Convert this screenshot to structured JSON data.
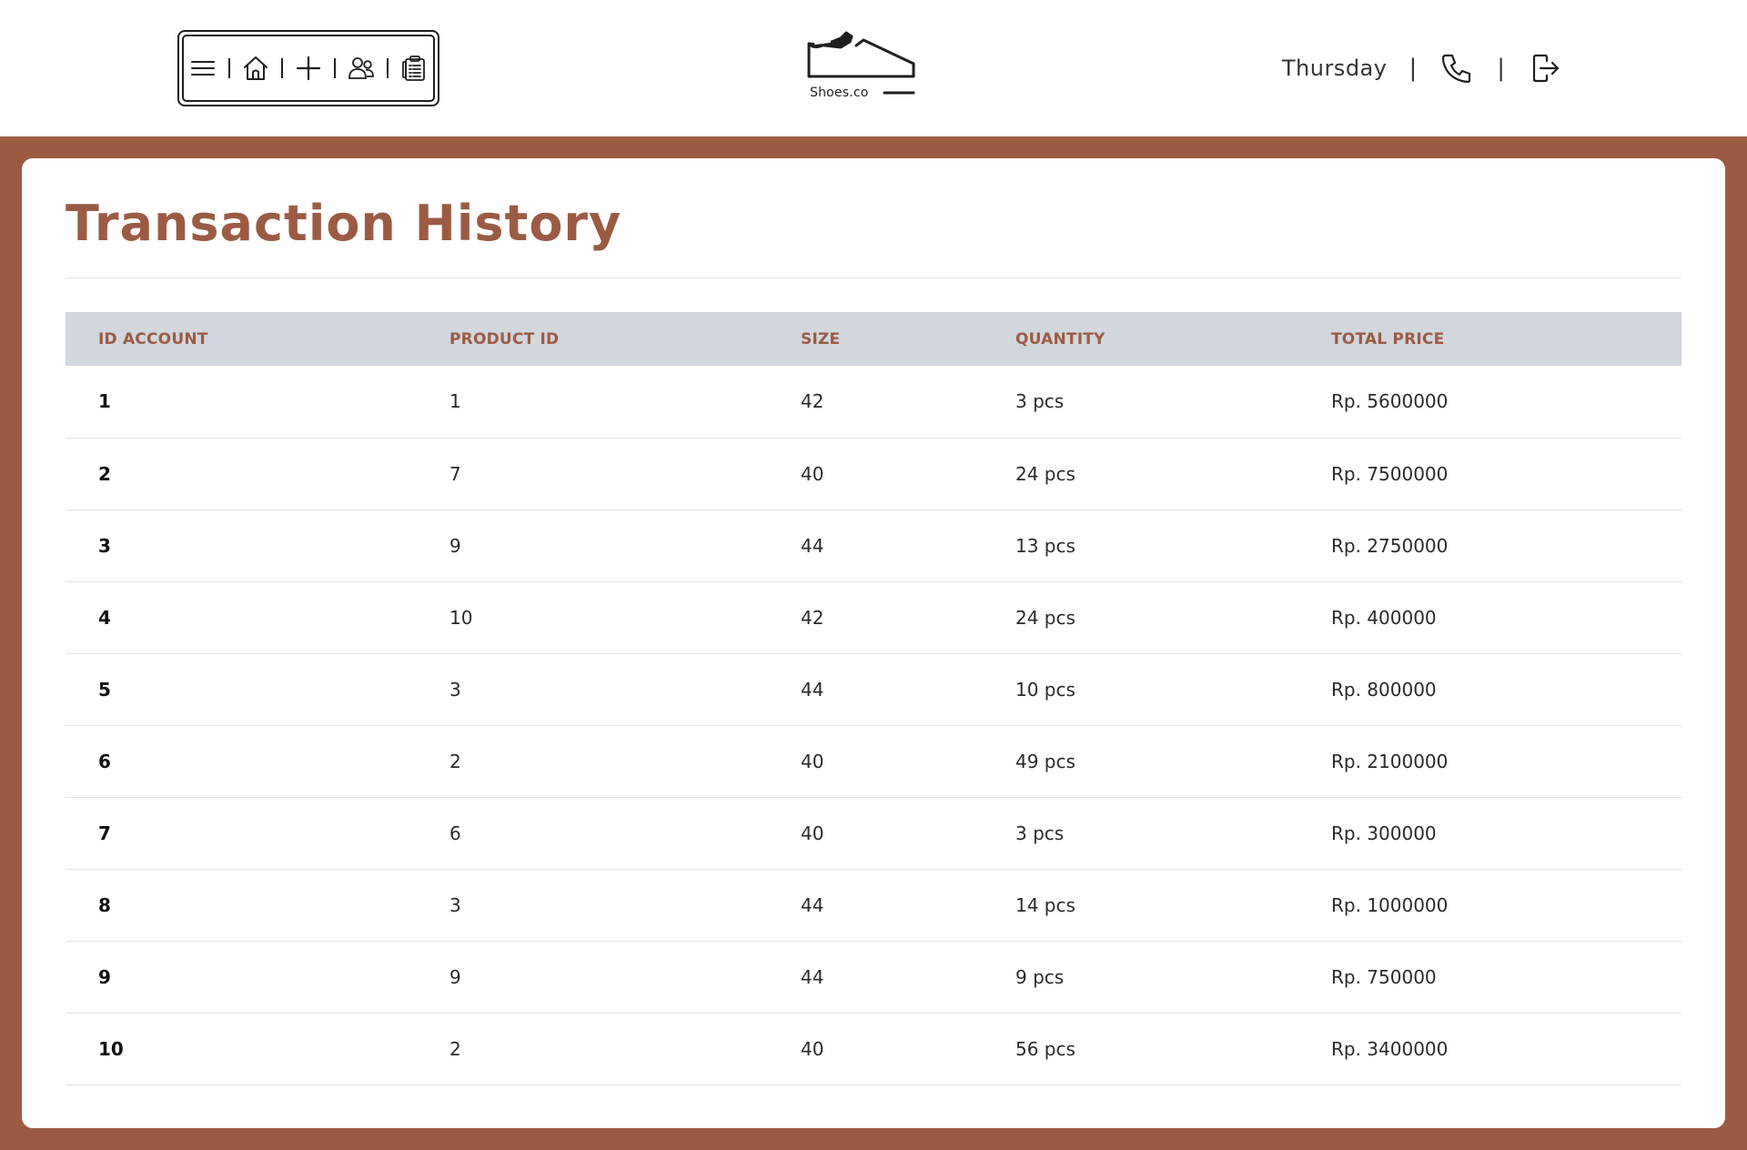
{
  "header": {
    "toolbar": {
      "buttons": [
        {
          "icon": "menu-icon"
        },
        {
          "icon": "home-icon"
        },
        {
          "icon": "plus-icon"
        },
        {
          "icon": "users-icon"
        },
        {
          "icon": "clipboard-icon"
        }
      ]
    },
    "logo": {
      "text": "Shoes.co",
      "icon": "shoe-icon"
    },
    "right": {
      "day": "Thursday",
      "separator": "|",
      "phone_icon": "phone-icon",
      "logout_icon": "logout-icon"
    }
  },
  "colors": {
    "accent": "#9b5b43",
    "table_header_bg": "#d2d6dd",
    "background": "#ffffff"
  },
  "main": {
    "title": "Transaction History",
    "table": {
      "columns": [
        "ID ACCOUNT",
        "PRODUCT ID",
        "SIZE",
        "QUANTITY",
        "TOTAL PRICE"
      ],
      "rows": [
        {
          "id_account": "1",
          "product_id": "1",
          "size": "42",
          "quantity": "3 pcs",
          "total_price": "Rp. 5600000"
        },
        {
          "id_account": "2",
          "product_id": "7",
          "size": "40",
          "quantity": "24 pcs",
          "total_price": "Rp. 7500000"
        },
        {
          "id_account": "3",
          "product_id": "9",
          "size": "44",
          "quantity": "13 pcs",
          "total_price": "Rp. 2750000"
        },
        {
          "id_account": "4",
          "product_id": "10",
          "size": "42",
          "quantity": "24 pcs",
          "total_price": "Rp. 400000"
        },
        {
          "id_account": "5",
          "product_id": "3",
          "size": "44",
          "quantity": "10 pcs",
          "total_price": "Rp. 800000"
        },
        {
          "id_account": "6",
          "product_id": "2",
          "size": "40",
          "quantity": "49 pcs",
          "total_price": "Rp. 2100000"
        },
        {
          "id_account": "7",
          "product_id": "6",
          "size": "40",
          "quantity": "3 pcs",
          "total_price": "Rp. 300000"
        },
        {
          "id_account": "8",
          "product_id": "3",
          "size": "44",
          "quantity": "14 pcs",
          "total_price": "Rp. 1000000"
        },
        {
          "id_account": "9",
          "product_id": "9",
          "size": "44",
          "quantity": "9 pcs",
          "total_price": "Rp. 750000"
        },
        {
          "id_account": "10",
          "product_id": "2",
          "size": "40",
          "quantity": "56 pcs",
          "total_price": "Rp. 3400000"
        }
      ]
    }
  }
}
